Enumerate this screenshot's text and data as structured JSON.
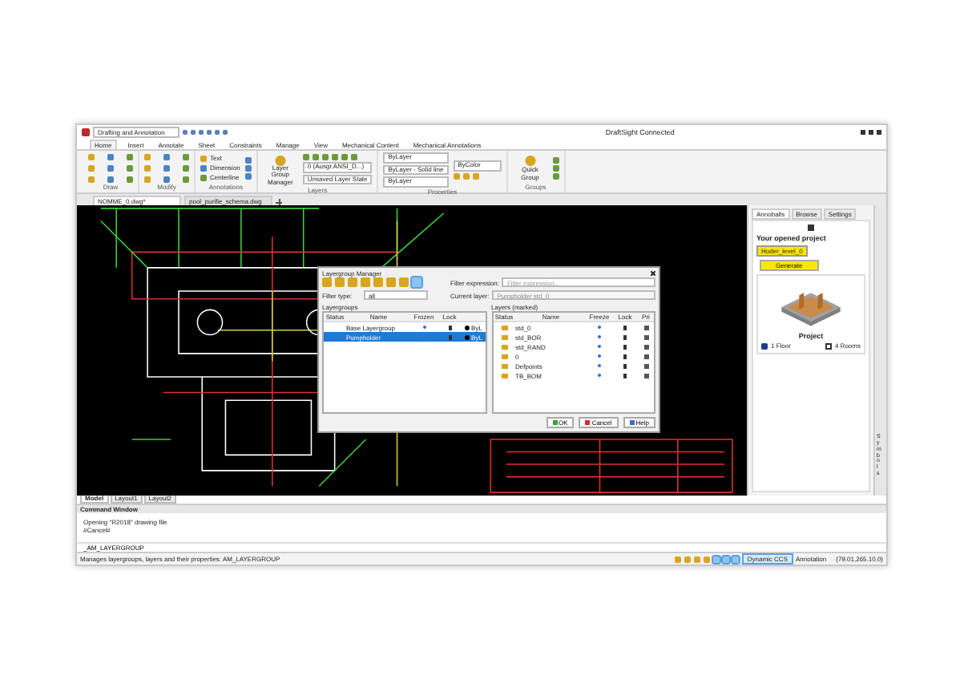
{
  "window": {
    "workspace": "Drafting and Annotation",
    "title": "DraftSight Connected"
  },
  "ribbon_tabs": [
    {
      "label": "Home",
      "selected": true
    },
    {
      "label": "Insert",
      "selected": false
    },
    {
      "label": "Annotate",
      "selected": false
    },
    {
      "label": "Sheet",
      "selected": false
    },
    {
      "label": "Constraints",
      "selected": false
    },
    {
      "label": "Manage",
      "selected": false
    },
    {
      "label": "View",
      "selected": false
    },
    {
      "label": "Mechanical Content",
      "selected": false
    },
    {
      "label": "Mechanical Annotations",
      "selected": false
    }
  ],
  "ribbon_groups": [
    {
      "kind": "icons",
      "name": "Draw"
    },
    {
      "kind": "icons",
      "name": "Modify"
    },
    {
      "kind": "text_tools",
      "name": "Annotations",
      "tools": [
        "Text",
        "Dimension",
        "Centerline"
      ]
    },
    {
      "kind": "layers",
      "name": "Layers",
      "button": "Layer Group Manager",
      "fields": [
        "0 (Ausgr.ANSI_D...)",
        "Unsaved Layer State"
      ]
    },
    {
      "kind": "properties",
      "name": "Properties",
      "fields": [
        "ByLayer",
        "ByLayer - Solid line",
        "ByLayer"
      ],
      "color_field": "ByColor"
    },
    {
      "kind": "groups",
      "name": "Groups",
      "button": "Quick Group"
    }
  ],
  "doc_tabs": [
    {
      "label": "NOMME_0.dwg*",
      "selected": true
    },
    {
      "label": "pool_purifie_schema.dwg",
      "selected": false
    }
  ],
  "dialog": {
    "title": "Layergroup Manager",
    "filter_type_label": "Filter type:",
    "filter_type": "all",
    "filter_expression_label": "Filter expression:",
    "filter_expression_placeholder": "Filter expression...",
    "current_layer_label": "Current layer:",
    "current_layer": "Pumpholder std_0",
    "layergroups_label": "Layergroups",
    "layers_label": "Layers (marked)",
    "group_columns": [
      "Status",
      "Name",
      "Frozen",
      "Lock"
    ],
    "groups": [
      {
        "name": "Base Layergroup",
        "selected": false,
        "color_name": "ByL"
      },
      {
        "name": "Pumpholder",
        "selected": true,
        "color_name": "ByL"
      }
    ],
    "layer_columns": [
      "Status",
      "Name",
      "Freeze",
      "Lock",
      "Pri"
    ],
    "layers": [
      "std_0",
      "std_BOR",
      "std_RAND",
      "0",
      "Defpoints",
      "TB_BOM"
    ],
    "buttons": [
      {
        "kind": "ok",
        "label": "OK"
      },
      {
        "kind": "cancel",
        "label": "Cancel"
      },
      {
        "kind": "help",
        "label": "Help"
      }
    ]
  },
  "side_panel": {
    "tabs": [
      {
        "label": "Annoballs",
        "selected": true
      },
      {
        "label": "Browse",
        "selected": false
      },
      {
        "label": "Settings",
        "selected": false
      }
    ],
    "heading": "Your opened project",
    "project_select": "Hoder_level_0",
    "generate": "Generate",
    "project_label": "Project",
    "floors": "1 Floor",
    "rooms": "4 Rooms",
    "vertical_tab": "Symbols"
  },
  "layout_tabs": [
    {
      "label": "Model",
      "selected": true
    },
    {
      "label": "Layout1",
      "selected": false
    },
    {
      "label": "Layout2",
      "selected": false
    }
  ],
  "command_window": {
    "title": "Command Window",
    "lines": [
      "Opening \"R2018\" drawing file",
      "#Cancel#"
    ],
    "input": "_AM_LAYERGROUP"
  },
  "status_bar": {
    "message": "Manages layergroups, layers and their properties: AM_LAYERGROUP",
    "dynamic": "Dynamic CCS",
    "annotation": "Annotation",
    "coords": "(79.01,265.10,0)"
  }
}
